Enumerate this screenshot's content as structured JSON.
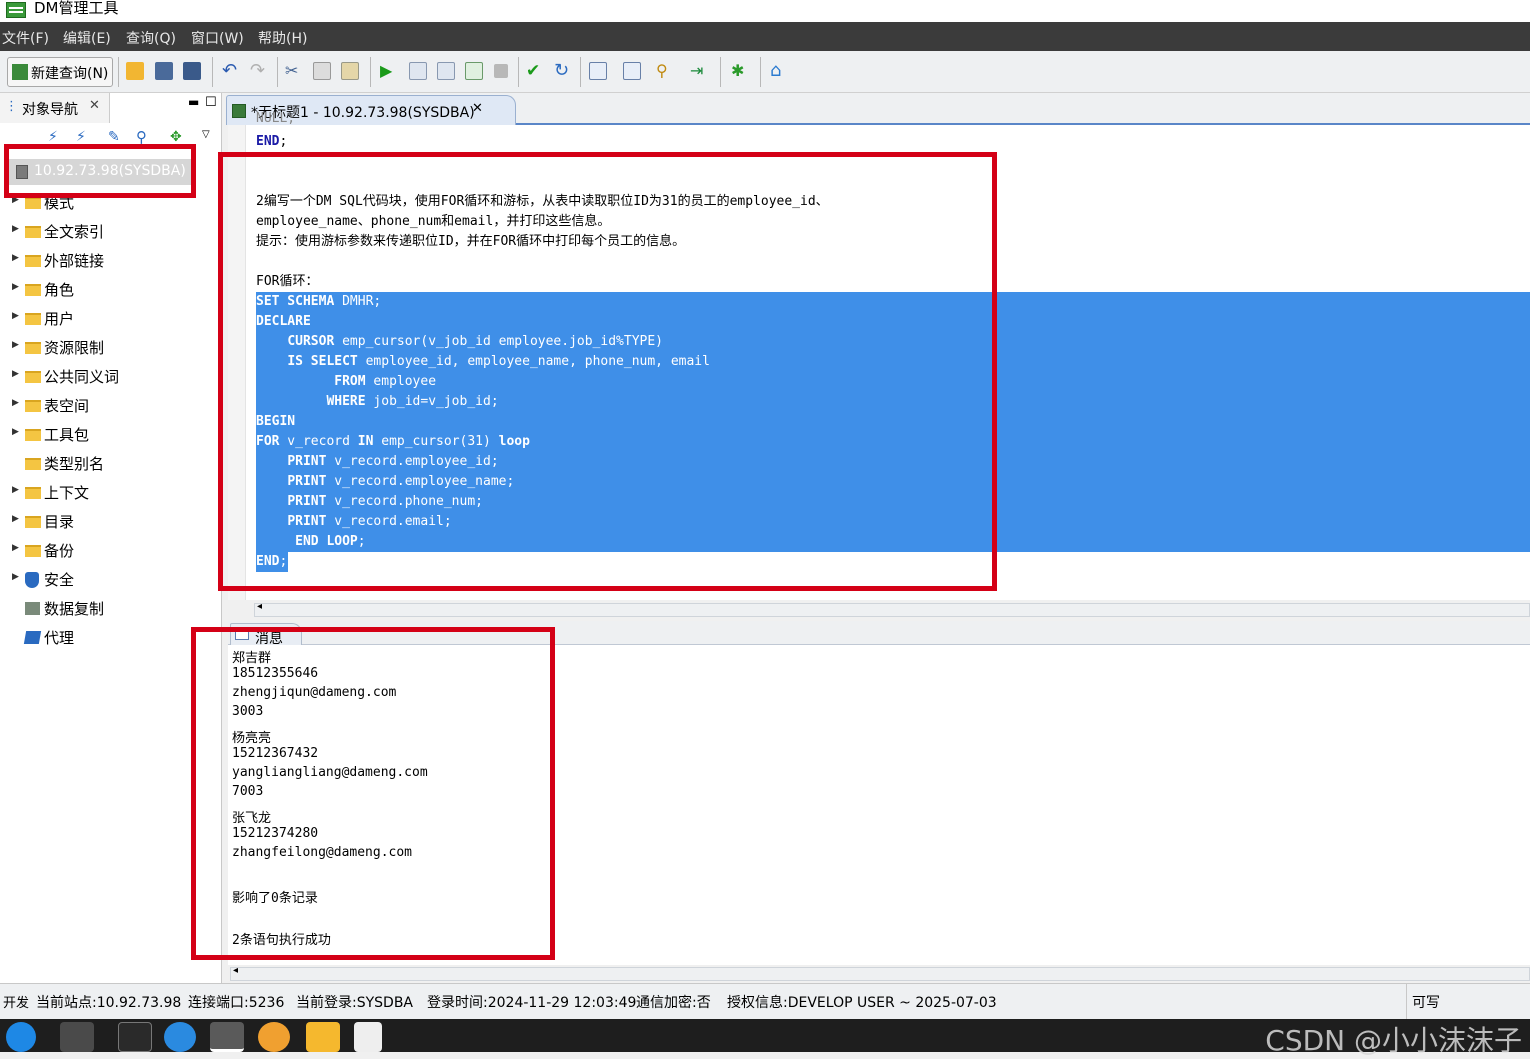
{
  "window": {
    "title": "DM管理工具"
  },
  "menu": [
    "文件(F)",
    "编辑(E)",
    "查询(Q)",
    "窗口(W)",
    "帮助(H)"
  ],
  "toolbar": {
    "new_query_label": "新建查询(N)",
    "icons": [
      "open-folder-icon",
      "save-icon",
      "save-all-icon",
      "undo-icon",
      "redo-icon",
      "cut-icon",
      "copy-icon",
      "paste-icon",
      "run-icon",
      "run-script-icon",
      "explain-icon",
      "format-icon",
      "stop-icon",
      "commit-icon",
      "rollback-icon",
      "plan-icon",
      "settings-icon",
      "find-icon",
      "step-icon",
      "debug-icon",
      "home-icon"
    ]
  },
  "navigator": {
    "tab_label": "对象导航",
    "connection": "10.92.73.98(SYSDBA)",
    "items": [
      {
        "label": "模式",
        "icon": "folder"
      },
      {
        "label": "全文索引",
        "icon": "folder"
      },
      {
        "label": "外部链接",
        "icon": "folder"
      },
      {
        "label": "角色",
        "icon": "folder"
      },
      {
        "label": "用户",
        "icon": "folder"
      },
      {
        "label": "资源限制",
        "icon": "folder"
      },
      {
        "label": "公共同义词",
        "icon": "folder"
      },
      {
        "label": "表空间",
        "icon": "folder"
      },
      {
        "label": "工具包",
        "icon": "folder"
      },
      {
        "label": "类型别名",
        "icon": "folder"
      },
      {
        "label": "上下文",
        "icon": "folder"
      },
      {
        "label": "目录",
        "icon": "folder"
      },
      {
        "label": "备份",
        "icon": "folder"
      },
      {
        "label": "安全",
        "icon": "shield"
      },
      {
        "label": "数据复制",
        "icon": "replicate"
      },
      {
        "label": "代理",
        "icon": "layers"
      }
    ]
  },
  "editor": {
    "tab_label": "*无标题1 - 10.92.73.98(SYSDBA)",
    "lines": [
      "END;",
      "",
      "",
      "2编写一个DM SQL代码块，使用FOR循环和游标，从表中读取职位ID为31的员工的employee_id、",
      "employee_name、phone_num和email，并打印这些信息。",
      "提示：使用游标参数来传递职位ID，并在FOR循环中打印每个员工的信息。",
      "",
      "FOR循环：",
      "SET SCHEMA DMHR;",
      "DECLARE",
      "    CURSOR emp_cursor(v_job_id employee.job_id%TYPE)",
      "    IS SELECT employee_id, employee_name, phone_num, email",
      "          FROM employee",
      "         WHERE job_id=v_job_id;",
      "BEGIN",
      "FOR v_record IN emp_cursor(31) loop",
      "    PRINT v_record.employee_id;",
      "    PRINT v_record.employee_name;",
      "    PRINT v_record.phone_num;",
      "    PRINT v_record.email;",
      "     END LOOP;",
      "END;"
    ]
  },
  "messages": {
    "tab_label": "消息",
    "lines": [
      "郑吉群",
      "18512355646",
      "zhengjiqun@dameng.com",
      "3003",
      "杨亮亮",
      "15212367432",
      "yangliangliang@dameng.com",
      "7003",
      "张飞龙",
      "15212374280",
      "zhangfeilong@dameng.com",
      "",
      "影响了0条记录",
      "",
      "2条语句执行成功"
    ]
  },
  "status": {
    "mode": "开发",
    "site": "当前站点:10.92.73.98",
    "port": "连接端口:5236",
    "login": "当前登录:SYSDBA",
    "login_time": "登录时间:2024-11-29 12:03:49",
    "encrypt": "通信加密:否",
    "license": "授权信息:DEVELOP USER ~ 2025-07-03",
    "writable": "可写"
  },
  "watermark": "CSDN @小小沫沫子",
  "colors": {
    "selection": "#3f8fe8",
    "annotation": "#d40016",
    "keyword": "#1a1aa6"
  }
}
